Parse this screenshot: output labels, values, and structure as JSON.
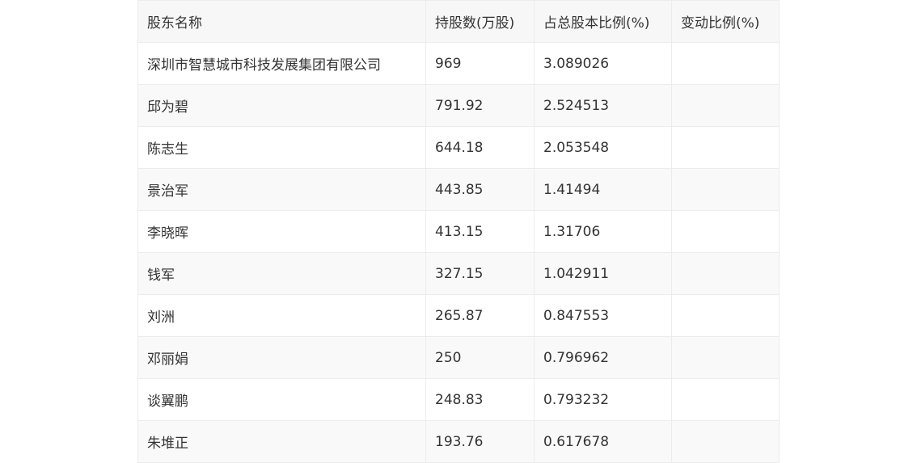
{
  "table": {
    "headers": [
      "股东名称",
      "持股数(万股)",
      "占总股本比例(%)",
      "变动比例(%)"
    ],
    "rows": [
      [
        "深圳市智慧城市科技发展集团有限公司",
        "969",
        "3.089026",
        ""
      ],
      [
        "邱为碧",
        "791.92",
        "2.524513",
        ""
      ],
      [
        "陈志生",
        "644.18",
        "2.053548",
        ""
      ],
      [
        "景治军",
        "443.85",
        "1.41494",
        ""
      ],
      [
        "李晓晖",
        "413.15",
        "1.31706",
        ""
      ],
      [
        "钱军",
        "327.15",
        "1.042911",
        ""
      ],
      [
        "刘洲",
        "265.87",
        "0.847553",
        ""
      ],
      [
        "邓丽娟",
        "250",
        "0.796962",
        ""
      ],
      [
        "谈翼鹏",
        "248.83",
        "0.793232",
        ""
      ],
      [
        "朱堆正",
        "193.76",
        "0.617678",
        ""
      ]
    ]
  }
}
